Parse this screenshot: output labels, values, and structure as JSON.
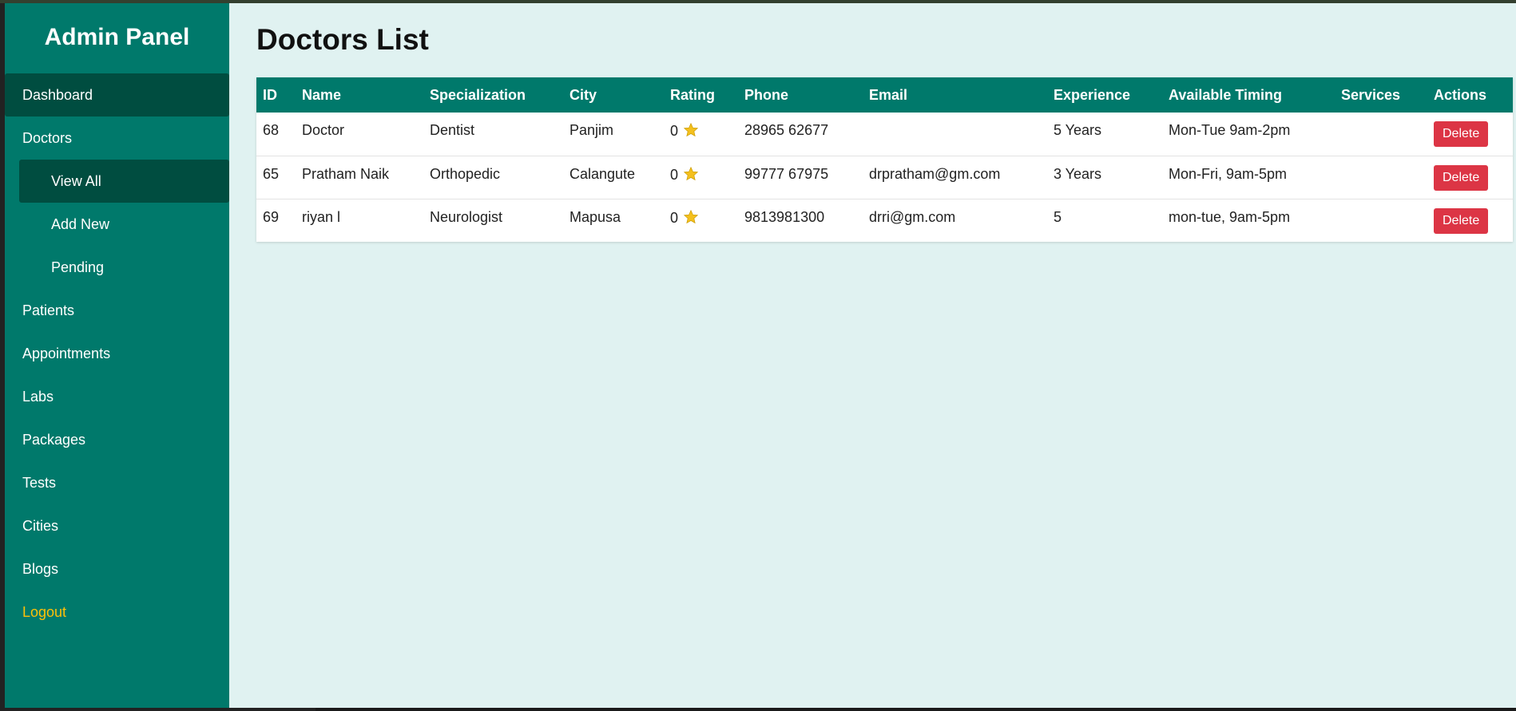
{
  "sidebar": {
    "title": "Admin Panel",
    "items": [
      {
        "label": "Dashboard"
      },
      {
        "label": "Doctors"
      },
      {
        "label": "View All"
      },
      {
        "label": "Add New"
      },
      {
        "label": "Pending"
      },
      {
        "label": "Patients"
      },
      {
        "label": "Appointments"
      },
      {
        "label": "Labs"
      },
      {
        "label": "Packages"
      },
      {
        "label": "Tests"
      },
      {
        "label": "Cities"
      },
      {
        "label": "Blogs"
      },
      {
        "label": "Logout"
      }
    ]
  },
  "main": {
    "title": "Doctors List",
    "table": {
      "headers": [
        "ID",
        "Name",
        "Specialization",
        "City",
        "Rating",
        "Phone",
        "Email",
        "Experience",
        "Available Timing",
        "Services",
        "Actions"
      ],
      "rows": [
        {
          "id": "68",
          "name": "Doctor",
          "specialization": "Dentist",
          "city": "Panjim",
          "rating": "0",
          "phone": "28965 62677",
          "email": "",
          "experience": "5 Years",
          "timing": "Mon-Tue 9am-2pm",
          "services": "",
          "action": "Delete"
        },
        {
          "id": "65",
          "name": "Pratham Naik",
          "specialization": "Orthopedic",
          "city": "Calangute",
          "rating": "0",
          "phone": "99777 67975",
          "email": "drpratham@gm.com",
          "experience": "3 Years",
          "timing": "Mon-Fri, 9am-5pm",
          "services": "",
          "action": "Delete"
        },
        {
          "id": "69",
          "name": "riyan l",
          "specialization": "Neurologist",
          "city": "Mapusa",
          "rating": "0",
          "phone": "9813981300",
          "email": "drri@gm.com",
          "experience": "5",
          "timing": "mon-tue, 9am-5pm",
          "services": "",
          "action": "Delete"
        }
      ]
    }
  },
  "colors": {
    "sidebar": "#00796b",
    "active": "#004d40",
    "background": "#e0f2f1",
    "header": "#00796b",
    "delete": "#dc3545",
    "logout": "#ffc107",
    "star": "#f4c01e"
  }
}
